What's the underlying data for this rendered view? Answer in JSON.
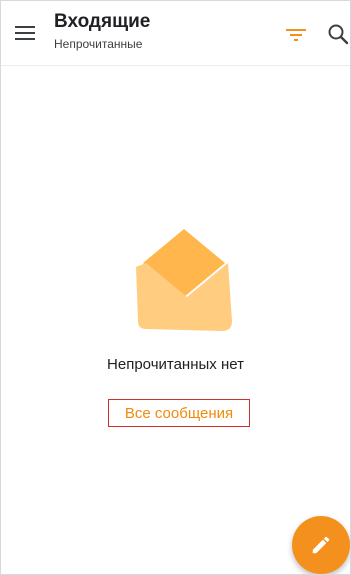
{
  "header": {
    "title": "Входящие",
    "subtitle": "Непрочитанные",
    "menu_icon": "menu-icon",
    "filter_icon": "filter-icon",
    "search_icon": "search-icon"
  },
  "empty_state": {
    "illustration": "envelope-icon",
    "message": "Непрочитанных нет",
    "action_label": "Все сообщения"
  },
  "fab": {
    "icon": "pencil-icon"
  },
  "colors": {
    "accent": "#f4911e",
    "accent_text": "#f08a0a",
    "highlight_border": "#d32f2f",
    "envelope_light": "#ffcc80",
    "envelope_dark": "#ffb74d"
  }
}
